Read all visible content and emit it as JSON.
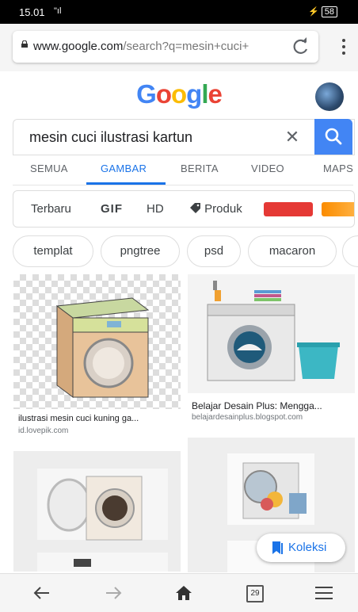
{
  "status_bar": {
    "time": "15.01",
    "signal": "\"ıl",
    "battery": "58"
  },
  "browser": {
    "url_host": "www.google.com",
    "url_path": "/search?q=mesin+cuci+",
    "tabs_count": "29"
  },
  "google": {
    "logo": [
      "G",
      "o",
      "o",
      "g",
      "l",
      "e"
    ],
    "logo_colors": [
      "#4285f4",
      "#ea4335",
      "#fbbc05",
      "#4285f4",
      "#34a853",
      "#ea4335"
    ],
    "query": "mesin cuci ilustrasi kartun",
    "clear_glyph": "✕",
    "tabs": [
      {
        "label": "SEMUA",
        "active": false
      },
      {
        "label": "GAMBAR",
        "active": true
      },
      {
        "label": "BERITA",
        "active": false
      },
      {
        "label": "VIDEO",
        "active": false
      },
      {
        "label": "MAPS",
        "active": false
      }
    ],
    "filters": {
      "recent": "Terbaru",
      "gif": "GIF",
      "hd": "HD",
      "product": "Produk",
      "color_swatches": [
        "#e53935",
        "#fb8c00"
      ]
    },
    "chips": [
      "templat",
      "pngtree",
      "psd",
      "macaron"
    ],
    "results": [
      {
        "caption": "ilustrasi mesin cuci kuning ga...",
        "domain": "id.lovepik.com"
      },
      {
        "caption": "Belajar Desain Plus: Mengga...",
        "domain": "belajardesainplus.blogspot.com"
      }
    ],
    "koleksi": "Koleksi"
  },
  "colors": {
    "accent": "#1a73e8",
    "search_button": "#4285f4"
  }
}
